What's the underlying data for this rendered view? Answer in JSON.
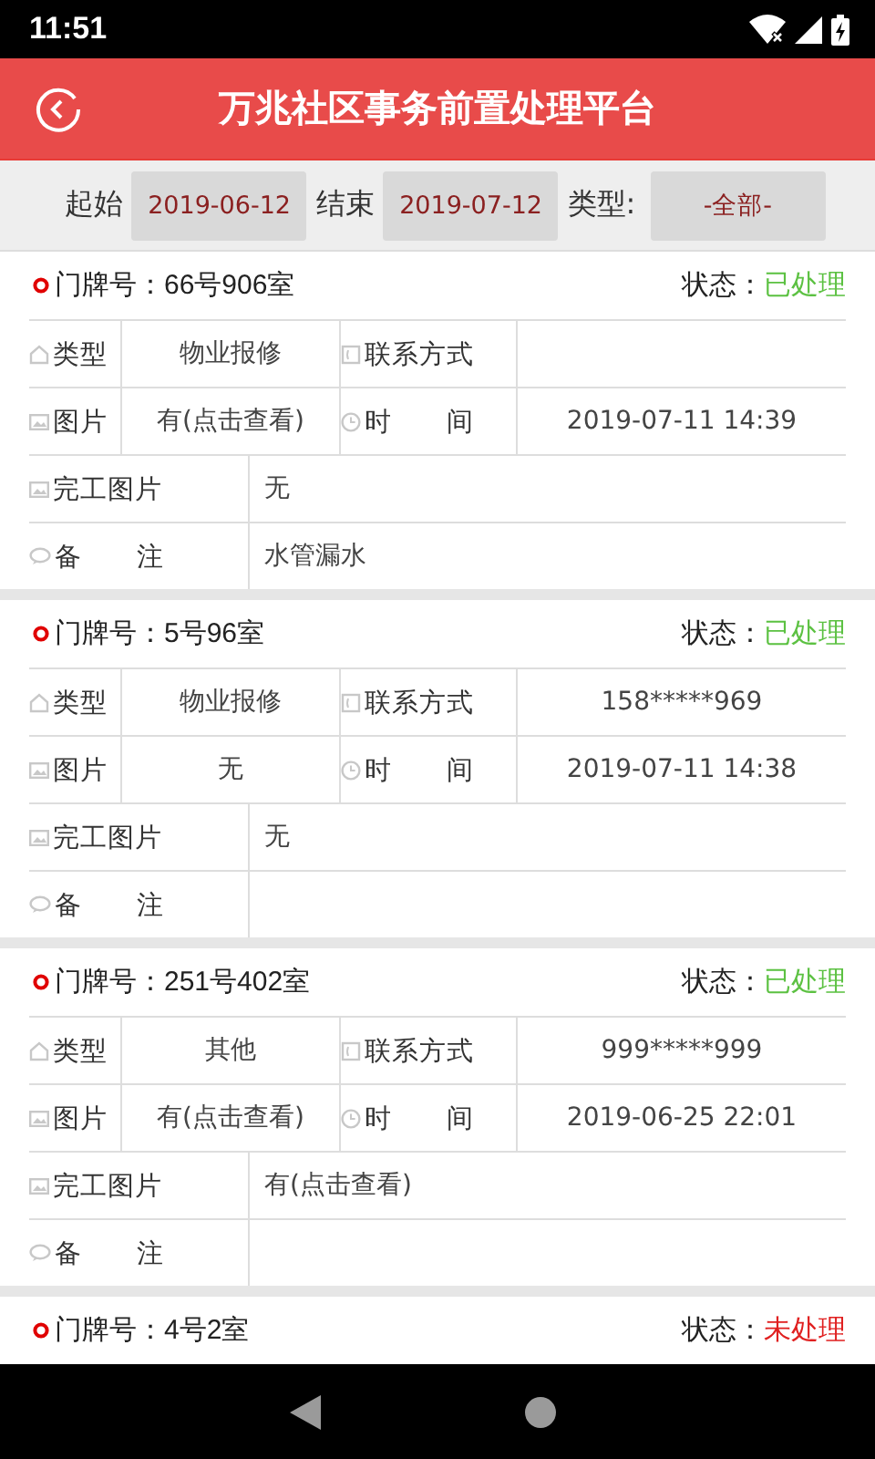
{
  "status_bar": {
    "time": "11:51"
  },
  "header": {
    "title": "万兆社区事务前置处理平台"
  },
  "filter": {
    "start_label": "起始",
    "start": "2019-06-12",
    "end_label": "结束",
    "end": "2019-07-12",
    "type_label": "类型:",
    "type": "-全部-"
  },
  "cards": [
    {
      "room_label": "门牌号：",
      "room": "66号906室",
      "status_label": "状态：",
      "status": "已处理",
      "processed": true,
      "rows": [
        {
          "cells": [
            {
              "kind": "label",
              "text": "类型"
            },
            {
              "kind": "value",
              "text": "物业报修"
            },
            {
              "kind": "label",
              "text": "联系方式"
            },
            {
              "kind": "value"
            }
          ]
        },
        {
          "cells": [
            {
              "kind": "label",
              "text": "图片"
            },
            {
              "kind": "value",
              "text": "有(点击查看)"
            },
            {
              "kind": "label",
              "text": "时　　间"
            },
            {
              "kind": "value",
              "text": "2019-07-11 14:39"
            }
          ]
        },
        {
          "cells": [
            {
              "kind": "label",
              "text": "完工图片"
            },
            {
              "kind": "value",
              "text": "无"
            }
          ]
        },
        {
          "cells": [
            {
              "kind": "label",
              "text": "备　　注"
            },
            {
              "kind": "value",
              "text": "水管漏水"
            }
          ]
        }
      ]
    },
    {
      "room_label": "门牌号：",
      "room": "5号96室",
      "status_label": "状态：",
      "status": "已处理",
      "processed": true,
      "rows": [
        {
          "cells": [
            {
              "kind": "label",
              "text": "类型"
            },
            {
              "kind": "value",
              "text": "物业报修"
            },
            {
              "kind": "label",
              "text": "联系方式"
            },
            {
              "kind": "value",
              "text": "158*****969"
            }
          ]
        },
        {
          "cells": [
            {
              "kind": "label",
              "text": "图片"
            },
            {
              "kind": "value",
              "text": "无"
            },
            {
              "kind": "label",
              "text": "时　　间"
            },
            {
              "kind": "value",
              "text": "2019-07-11 14:38"
            }
          ]
        },
        {
          "cells": [
            {
              "kind": "label",
              "text": "完工图片"
            },
            {
              "kind": "value",
              "text": "无"
            }
          ]
        },
        {
          "cells": [
            {
              "kind": "label",
              "text": "备　　注"
            },
            {
              "kind": "value"
            }
          ]
        }
      ]
    },
    {
      "room_label": "门牌号：",
      "room": "251号402室",
      "status_label": "状态：",
      "status": "已处理",
      "processed": true,
      "rows": [
        {
          "cells": [
            {
              "kind": "label",
              "text": "类型"
            },
            {
              "kind": "value",
              "text": "其他"
            },
            {
              "kind": "label",
              "text": "联系方式"
            },
            {
              "kind": "value",
              "text": "999*****999"
            }
          ]
        },
        {
          "cells": [
            {
              "kind": "label",
              "text": "图片"
            },
            {
              "kind": "value",
              "text": "有(点击查看)"
            },
            {
              "kind": "label",
              "text": "时　　间"
            },
            {
              "kind": "value",
              "text": "2019-06-25 22:01"
            }
          ]
        },
        {
          "cells": [
            {
              "kind": "label",
              "text": "完工图片"
            },
            {
              "kind": "value",
              "text": "有(点击查看)"
            }
          ]
        },
        {
          "cells": [
            {
              "kind": "label",
              "text": "备　　注"
            },
            {
              "kind": "value"
            }
          ]
        }
      ]
    },
    {
      "room_label": "门牌号：",
      "room": "4号2室",
      "status_label": "状态：",
      "status": "未处理",
      "processed": false
    }
  ]
}
